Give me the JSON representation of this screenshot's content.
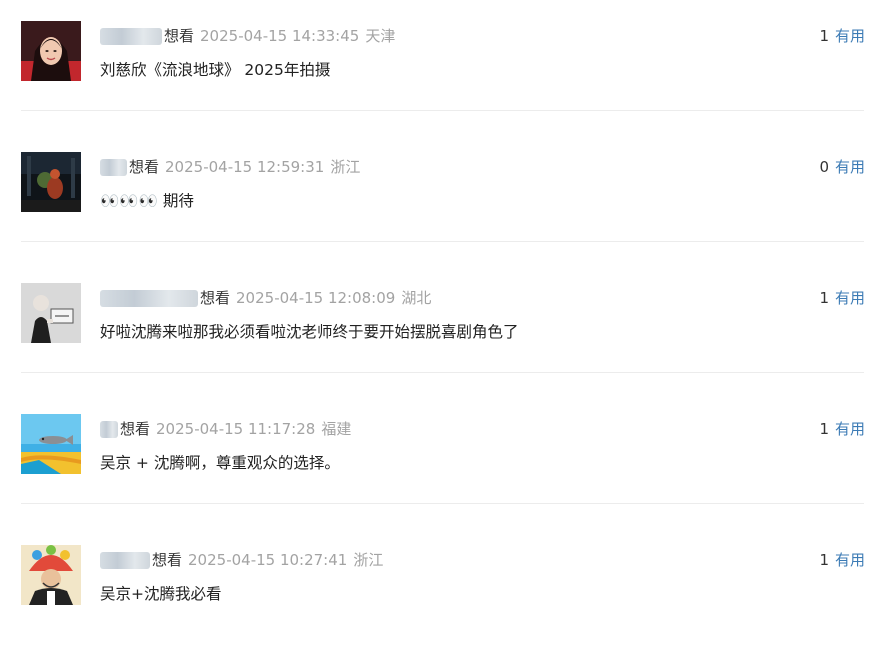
{
  "comments": [
    {
      "avatar": "avatar-woman-red",
      "user": "",
      "want": "想看",
      "time": "2025-04-15 14:33:45",
      "location": "天津",
      "votes": "1",
      "vote_label": "有用",
      "text": "刘慈欣《流浪地球》 2025年拍摄"
    },
    {
      "avatar": "avatar-dark-scene",
      "user": "",
      "want": "想看",
      "time": "2025-04-15 12:59:31",
      "location": "浙江",
      "votes": "0",
      "vote_label": "有用",
      "text": "👀👀👀 期待"
    },
    {
      "avatar": "avatar-man-sign",
      "user": "",
      "want": "想看",
      "time": "2025-04-15 12:08:09",
      "location": "湖北",
      "votes": "1",
      "vote_label": "有用",
      "text": "好啦沈腾来啦那我必须看啦沈老师终于要开始摆脱喜剧角色了"
    },
    {
      "avatar": "avatar-beach-fish",
      "user": "",
      "want": "想看",
      "time": "2025-04-15 11:17:28",
      "location": "福建",
      "votes": "1",
      "vote_label": "有用",
      "text": "吴京 + 沈腾啊，尊重观众的选择。"
    },
    {
      "avatar": "avatar-colorful-hat",
      "user": "",
      "want": "想看",
      "time": "2025-04-15 10:27:41",
      "location": "浙江",
      "votes": "1",
      "vote_label": "有用",
      "text": "吴京+沈腾我必看"
    }
  ]
}
